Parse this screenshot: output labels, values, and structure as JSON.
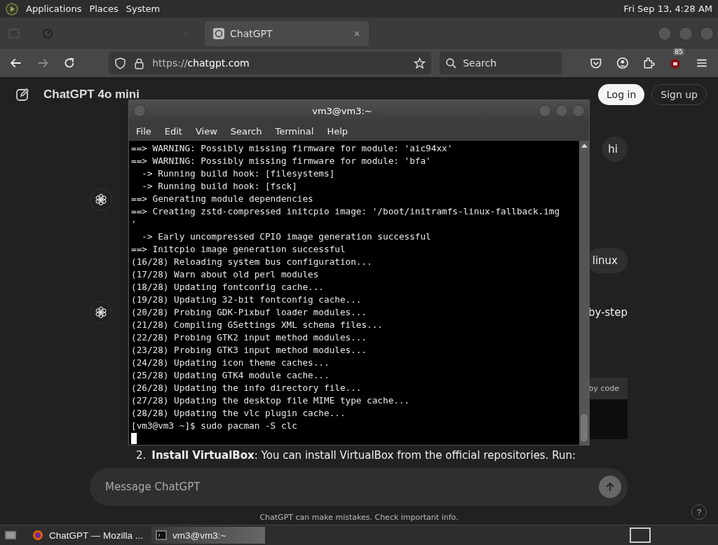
{
  "top_panel": {
    "menus": [
      "Applications",
      "Places",
      "System"
    ],
    "clock": "Fri Sep 13, 4:28 AM"
  },
  "browser": {
    "tabs": [
      {
        "selected": false
      },
      {
        "label": "ChatGPT",
        "selected": true
      }
    ],
    "url_scheme": "https://",
    "url_host": "chatgpt.com",
    "search_placeholder": "Search",
    "extension_badge": "85"
  },
  "chat": {
    "model": "ChatGPT 4o mini",
    "login": "Log in",
    "signup": "Sign up",
    "messages": [
      {
        "kind": "user",
        "text": "hi"
      },
      {
        "kind": "assistant"
      },
      {
        "kind": "user",
        "text": "linux"
      },
      {
        "kind": "assistant",
        "text": "by-step"
      },
      {
        "kind": "code",
        "text": "by code"
      },
      {
        "kind": "list_item",
        "number": "2.",
        "text": "**Install VirtualBox**: You can install VirtualBox from the official repositories. Run:"
      }
    ],
    "input_placeholder": "Message ChatGPT",
    "disclaimer": "ChatGPT can make mistakes. Check important info.",
    "help": "?"
  },
  "terminal": {
    "title": "vm3@vm3:~",
    "menus": [
      "File",
      "Edit",
      "View",
      "Search",
      "Terminal",
      "Help"
    ],
    "lines": [
      "==> WARNING: Possibly missing firmware for module: 'aic94xx'",
      "==> WARNING: Possibly missing firmware for module: 'bfa'",
      "  -> Running build hook: [filesystems]",
      "  -> Running build hook: [fsck]",
      "==> Generating module dependencies",
      "==> Creating zstd-compressed initcpio image: '/boot/initramfs-linux-fallback.img",
      "'",
      "  -> Early uncompressed CPIO image generation successful",
      "==> Initcpio image generation successful",
      "(16/28) Reloading system bus configuration...",
      "(17/28) Warn about old perl modules",
      "(18/28) Updating fontconfig cache...",
      "(19/28) Updating 32-bit fontconfig cache...",
      "(20/28) Probing GDK-Pixbuf loader modules...",
      "(21/28) Compiling GSettings XML schema files...",
      "(22/28) Probing GTK2 input method modules...",
      "(23/28) Probing GTK3 input method modules...",
      "(24/28) Updating icon theme caches...",
      "(25/28) Updating GTK4 module cache...",
      "(26/28) Updating the info directory file...",
      "(27/28) Updating the desktop file MIME type cache...",
      "(28/28) Updating the vlc plugin cache...",
      "[vm3@vm3 ~]$ sudo pacman -S clc"
    ]
  },
  "taskbar": {
    "items": [
      {
        "label": "ChatGPT — Mozilla ...",
        "selected": false
      },
      {
        "label": "vm3@vm3:~",
        "selected": true
      }
    ]
  }
}
